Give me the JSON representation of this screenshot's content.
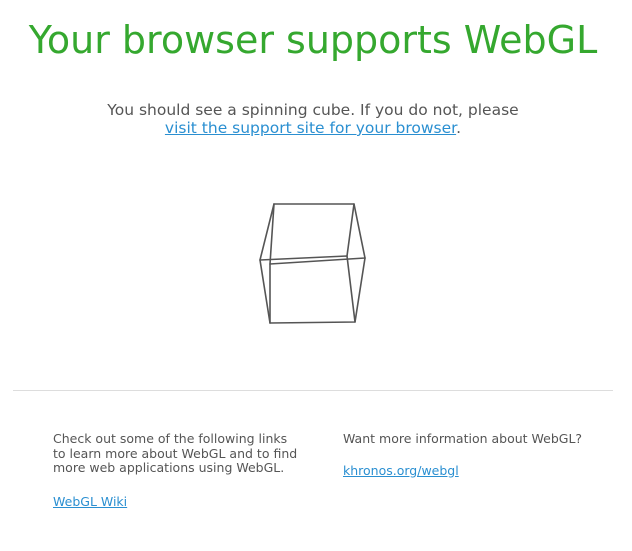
{
  "header": {
    "title": "Your browser supports WebGL"
  },
  "intro": {
    "text_before": "You should see a spinning cube. If you do not, please",
    "link_text": "visit the support site for your browser",
    "text_after": "."
  },
  "cube": {
    "stroke_color": "#555555"
  },
  "footer": {
    "left": {
      "text": "Check out some of the following links to learn more about WebGL and to find more web applications using WebGL.",
      "link_text": "WebGL Wiki"
    },
    "right": {
      "text": "Want more information about WebGL?",
      "link_text": "khronos.org/webgl"
    }
  },
  "colors": {
    "title": "#35a82f",
    "link": "#2a8fd1",
    "body_text": "#555555",
    "divider": "#dddddd"
  }
}
